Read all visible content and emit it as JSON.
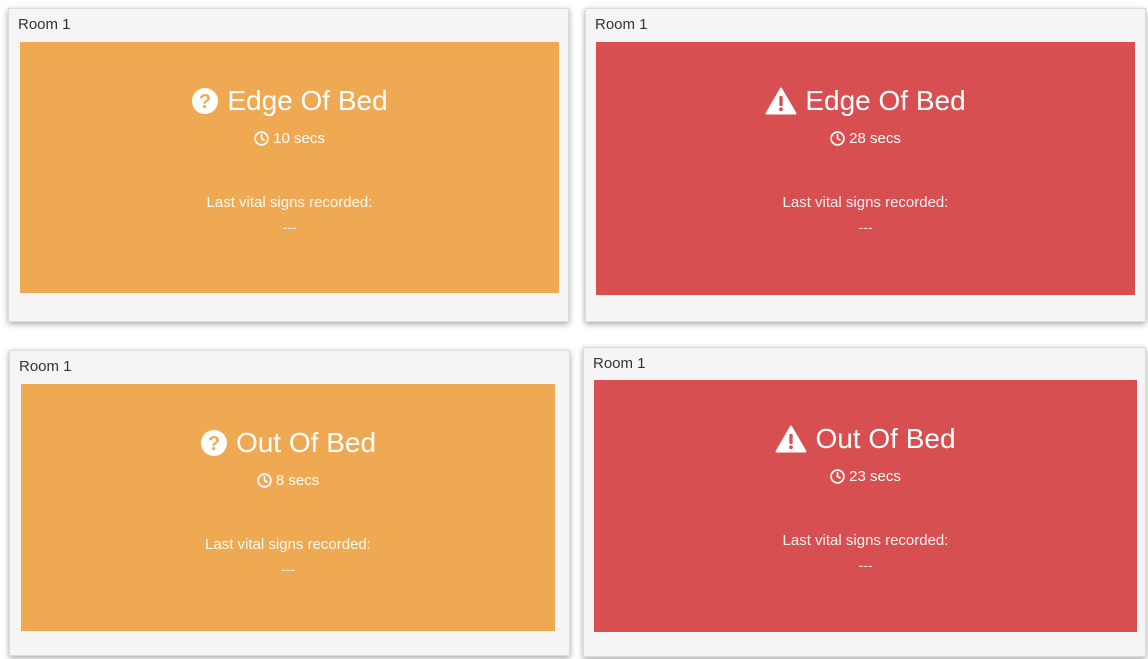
{
  "colors": {
    "warning_orange": "#F0A953",
    "alert_red": "#D84F51",
    "text_white": "#FFFFFF",
    "panel_bg": "#F5F5F5"
  },
  "cards": [
    {
      "room": "Room 1",
      "status": "Edge Of Bed",
      "timer": "10 secs",
      "vitals_label": "Last vital signs recorded:",
      "vitals_value": "---",
      "status_icon": "question-circle-icon",
      "color": "#F0A953"
    },
    {
      "room": "Room 1",
      "status": "Edge Of Bed",
      "timer": "28 secs",
      "vitals_label": "Last vital signs recorded:",
      "vitals_value": "---",
      "status_icon": "warning-triangle-icon",
      "color": "#D84F51"
    },
    {
      "room": "Room 1",
      "status": "Out Of Bed",
      "timer": "8 secs",
      "vitals_label": "Last vital signs recorded:",
      "vitals_value": "---",
      "status_icon": "question-circle-icon",
      "color": "#F0A953"
    },
    {
      "room": "Room 1",
      "status": "Out Of Bed",
      "timer": "23 secs",
      "vitals_label": "Last vital signs recorded:",
      "vitals_value": "---",
      "status_icon": "warning-triangle-icon",
      "color": "#D84F51"
    }
  ]
}
